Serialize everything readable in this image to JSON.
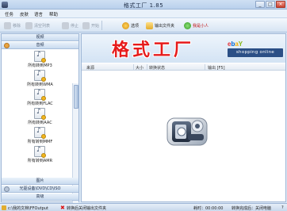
{
  "window": {
    "title": "格式工厂 1.85"
  },
  "menu": [
    "任务",
    "皮肤",
    "语言",
    "帮助"
  ],
  "toolbar": {
    "buttons": [
      {
        "label": "移除",
        "icon": "remove-icon",
        "enabled": false
      },
      {
        "label": "清空列表",
        "icon": "clear-list-icon",
        "enabled": false
      },
      {
        "label": "停止",
        "icon": "stop-icon",
        "enabled": false
      },
      {
        "label": "开始",
        "icon": "start-icon",
        "enabled": false
      }
    ],
    "options_label": "选项",
    "output_folder_label": "输出文件夹",
    "home_label": "我是小人"
  },
  "categories": {
    "video": "视频",
    "audio": "音频",
    "image": "图片",
    "rom": "光驱设备\\DVD\\CD\\ISO",
    "advanced": "高级"
  },
  "audio_items": [
    {
      "label": "所有转到MP3"
    },
    {
      "label": "所有转到WMA"
    },
    {
      "label": "所有转到FLAC"
    },
    {
      "label": "所有转到AAC"
    },
    {
      "label": "所有转到MMF"
    },
    {
      "label": "所有转到AMR"
    }
  ],
  "banner": {
    "title": "格式工厂",
    "shop_text": "shopping online"
  },
  "table_headers": [
    "来源",
    "大小",
    "转换状态",
    "输出 [F5]"
  ],
  "status": {
    "output_path": "c:\\我的文档\\FFOutput",
    "checkbox_label": "转换后关闭输出文件夹",
    "time_label": "耗时：00:00:00",
    "after_label": "转换完成后：关闭电脑",
    "help": "?"
  },
  "colors": {
    "banner_title": "#e61b1b",
    "accent": "#2b4f86"
  }
}
